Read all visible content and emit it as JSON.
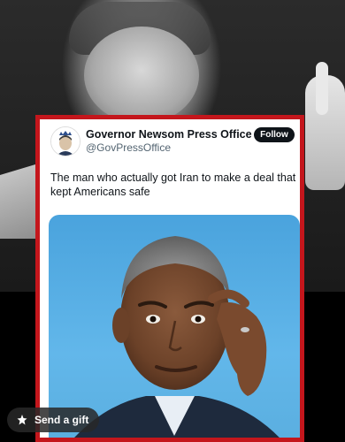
{
  "tweet": {
    "account_name": "Governor Newsom Press Office",
    "handle": "@GovPressOffice",
    "follow_label": "Follow",
    "text": "The man who actually got Iran to make a deal that kept Americans safe"
  },
  "overlay": {
    "send_gift_label": "Send a gift"
  },
  "colors": {
    "card_border": "#c4161c",
    "verified_badge": "#7b8a98",
    "photo_background": "#4aa3dd"
  },
  "icons": {
    "verified": "verified-badge-icon",
    "gift": "gift-icon"
  }
}
